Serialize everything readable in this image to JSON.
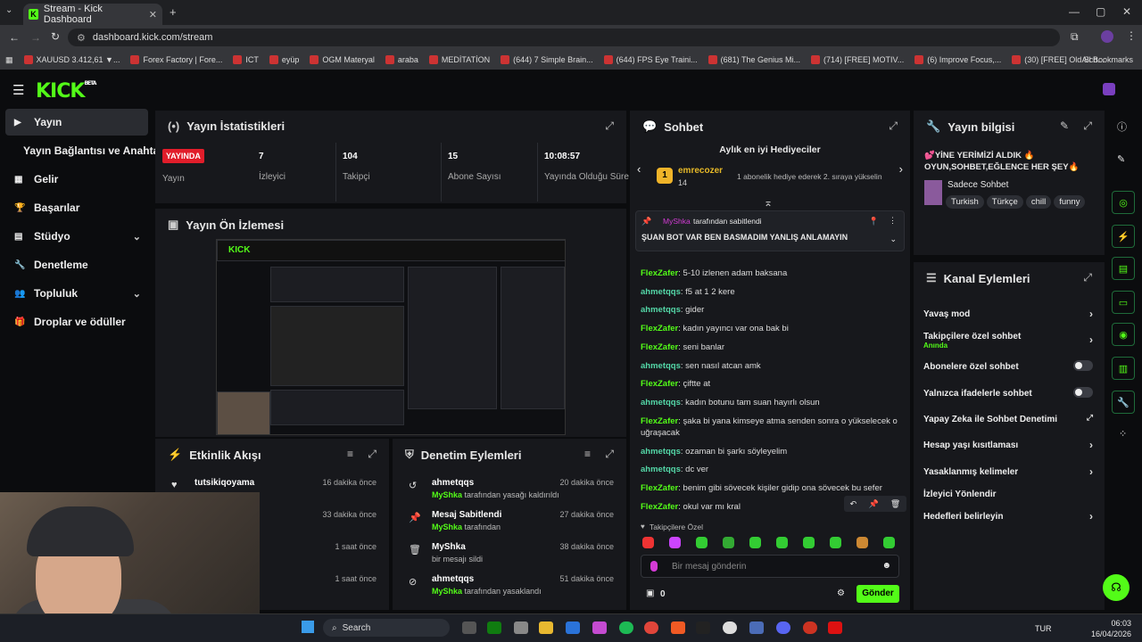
{
  "browser": {
    "tab_title": "Stream - Kick Dashboard",
    "url": "dashboard.kick.com/stream",
    "bookmarks": [
      "XAUUSD 3.412,61 ▼...",
      "Forex Factory | Fore...",
      "ICT",
      "eyüp",
      "OGM Materyal",
      "araba",
      "MEDİTATİON",
      "(644) 7 Simple Brain...",
      "(644) FPS Eye Traini...",
      "(681) The Genius Mi...",
      "(714) [FREE] MOTIV...",
      "(6) Improve Focus,...",
      "(30) [FREE] Old Sch..."
    ],
    "all_bookmarks": "All Bookmarks"
  },
  "app": {
    "logo": "KICK",
    "beta": "BETA"
  },
  "sidebar": {
    "items": [
      {
        "label": "Yayın"
      },
      {
        "label": "Yayın Bağlantısı ve Anahtarı"
      },
      {
        "label": "Gelir"
      },
      {
        "label": "Başarılar"
      },
      {
        "label": "Stüdyo"
      },
      {
        "label": "Denetleme"
      },
      {
        "label": "Topluluk"
      },
      {
        "label": "Droplar ve ödüller"
      }
    ]
  },
  "stats": {
    "title": "Yayın İstatistikleri",
    "live": "YAYINDA",
    "live_label": "Yayın",
    "items": [
      {
        "value": "7",
        "label": "İzleyici"
      },
      {
        "value": "104",
        "label": "Takipçi"
      },
      {
        "value": "15",
        "label": "Abone Sayısı"
      },
      {
        "value": "10:08:57",
        "label": "Yayında Olduğu Süre"
      }
    ]
  },
  "preview": {
    "title": "Yayın Ön İzlemesi"
  },
  "activity": {
    "title": "Etkinlik Akışı",
    "items": [
      {
        "name": "tutsikiqoyama",
        "time": "16 dakika önce"
      },
      {
        "name": "",
        "time": "33 dakika önce"
      },
      {
        "name": "",
        "time": "1 saat önce"
      },
      {
        "name": "",
        "time": "1 saat önce"
      }
    ]
  },
  "moderation": {
    "title": "Denetim Eylemleri",
    "items": [
      {
        "name": "ahmetqqs",
        "by": "MyShka",
        "text": "tarafından yasağı kaldırıldı",
        "time": "20 dakika önce"
      },
      {
        "name": "Mesaj Sabitlendi",
        "by": "MyShka",
        "text": "tarafından",
        "time": "27 dakika önce"
      },
      {
        "name": "MyShka",
        "by": "",
        "text": "bir mesajı sildi",
        "time": "38 dakika önce"
      },
      {
        "name": "ahmetqqs",
        "by": "MyShka",
        "text": "tarafından yasaklandı",
        "time": "51 dakika önce"
      }
    ]
  },
  "chat": {
    "title": "Sohbet",
    "gifters_title": "Aylık en iyi Hediyeciler",
    "gifter_rank": "1",
    "gifter_name": "emrecozer",
    "gifter_count": "14",
    "gifter_note": "1 abonelik hediye ederek 2. sıraya yükselin",
    "pinned_by": "MyShka",
    "pinned_suffix": "tarafından sabitlendi",
    "pinned_text": "ŞUAN BOT VAR BEN BASMADIM YANLIŞ ANLAMAYIN",
    "messages": [
      {
        "user": "FlexZafer",
        "text": "5-10 izlenen adam baksana"
      },
      {
        "user": "ahmetqqs",
        "text": "f5 at 1 2 kere"
      },
      {
        "user": "ahmetqqs",
        "text": "gider"
      },
      {
        "user": "FlexZafer",
        "text": "kadın yayıncı var ona bak bi"
      },
      {
        "user": "FlexZafer",
        "text": "seni banlar"
      },
      {
        "user": "ahmetqqs",
        "text": "sen nasıl atcan amk"
      },
      {
        "user": "FlexZafer",
        "text": "çiftte at"
      },
      {
        "user": "ahmetqqs",
        "text": "kadın botunu tam suan hayırlı olsun"
      },
      {
        "user": "FlexZafer",
        "text": "şaka bi yana kimseye atma senden sonra o yükselecek o uğraşacak"
      },
      {
        "user": "ahmetqqs",
        "text": "ozaman bi şarkı söyleyelim"
      },
      {
        "user": "ahmetqqs",
        "text": "dc ver"
      },
      {
        "user": "FlexZafer",
        "text": "benim gibi sövecek kişiler gidip ona sövecek bu sefer"
      },
      {
        "user": "FlexZafer",
        "text": "okul var mı kral"
      }
    ],
    "emote_label": "Takipçilere Özel",
    "placeholder": "Bir mesaj gönderin",
    "points": "0",
    "send": "Gönder"
  },
  "streaminfo": {
    "title": "Yayın bilgisi",
    "stream_title": "💕YİNE YERİMİZİ ALDIK 🔥 OYUN,SOHBET,EĞLENCE HER ŞEY🔥",
    "category": "Sadece Sohbet",
    "tags": [
      "Turkish",
      "Türkçe",
      "chill",
      "funny"
    ]
  },
  "channel": {
    "title": "Kanal Eylemleri",
    "items": [
      {
        "label": "Yavaş mod",
        "sub": ""
      },
      {
        "label": "Takipçilere özel sohbet",
        "sub": "Anında"
      },
      {
        "label": "Abonelere özel sohbet",
        "sub": ""
      },
      {
        "label": "Yalnızca ifadelerle sohbet",
        "sub": ""
      },
      {
        "label": "Yapay Zeka ile Sohbet Denetimi",
        "sub": ""
      },
      {
        "label": "Hesap yaşı kısıtlaması",
        "sub": ""
      },
      {
        "label": "Yasaklanmış kelimeler",
        "sub": ""
      },
      {
        "label": "İzleyici Yönlendir",
        "sub": ""
      },
      {
        "label": "Hedefleri belirleyin",
        "sub": ""
      }
    ]
  },
  "taskbar": {
    "search": "Search",
    "lang": "TUR",
    "time": "06:03",
    "date": "16/04/2026"
  },
  "colors": {
    "accent": "#53fc18",
    "live": "#e11d2a",
    "bg": "#0b0c0e",
    "panel": "#17181c"
  }
}
